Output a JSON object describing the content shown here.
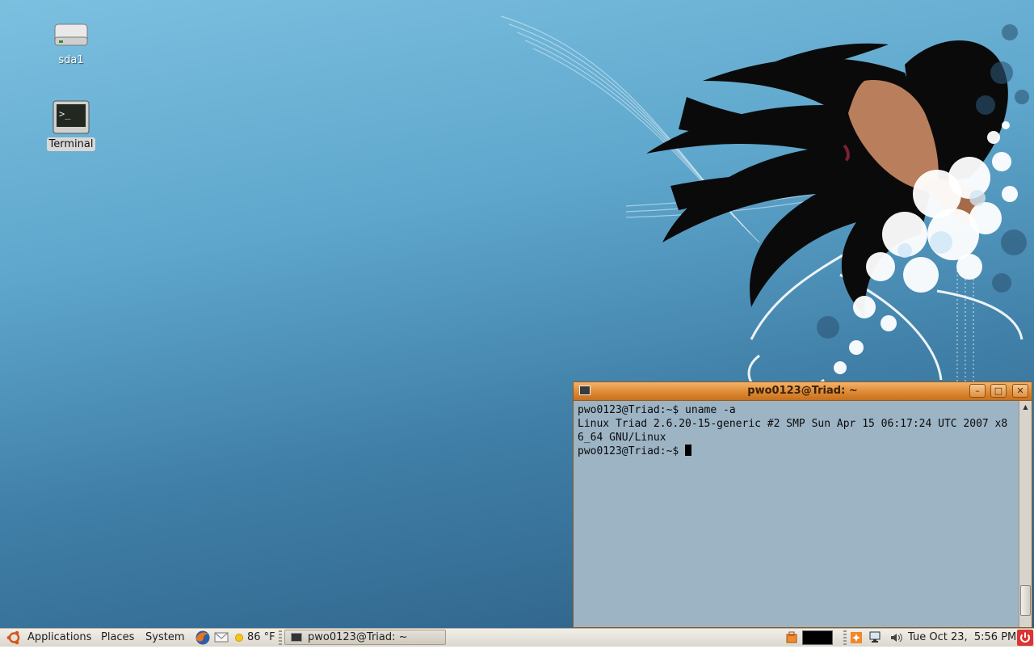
{
  "desktop": {
    "icons": [
      {
        "label": "sda1",
        "icon": "drive-icon"
      },
      {
        "label": "Terminal",
        "icon": "terminal-icon"
      }
    ]
  },
  "terminal": {
    "title": "pwo0123@Triad: ~",
    "buttons": {
      "minimize": "–",
      "maximize": "□",
      "close": "✕"
    },
    "lines": [
      "pwo0123@Triad:~$ uname -a",
      "Linux Triad 2.6.20-15-generic #2 SMP Sun Apr 15 06:17:24 UTC 2007 x8",
      "6_64 GNU/Linux",
      "pwo0123@Triad:~$ "
    ]
  },
  "panel": {
    "menus": [
      "Applications",
      "Places",
      "System"
    ],
    "weather": "86 °F",
    "taskbar_item": "pwo0123@Triad: ~",
    "clock": "Tue Oct 23,  5:56 PM"
  },
  "colors": {
    "titlebar_accent": "#dd8a35",
    "panel_bg": "#e8e4dc",
    "desktop_bg": "#5ea6cc"
  }
}
